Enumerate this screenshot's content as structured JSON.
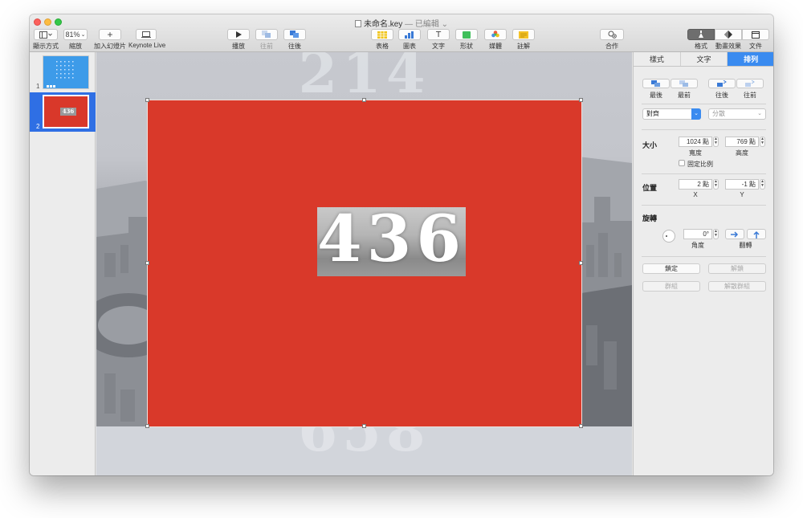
{
  "window": {
    "title": "未命名.key",
    "title_suffix": "— 已編輯",
    "title_chevron": "⌄"
  },
  "toolbar": {
    "view": {
      "label": "顯示方式"
    },
    "zoom": {
      "value": "81%",
      "label": "縮放"
    },
    "add_slide": {
      "label": "加入幻燈片"
    },
    "keynote_live": {
      "label": "Keynote Live"
    },
    "play": {
      "label": "播放"
    },
    "back": {
      "label": "往前"
    },
    "forward": {
      "label": "往後"
    },
    "table": {
      "label": "表格"
    },
    "chart": {
      "label": "圖表"
    },
    "text": {
      "label": "文字",
      "glyph": "T"
    },
    "shape": {
      "label": "形狀"
    },
    "media": {
      "label": "媒體"
    },
    "comment": {
      "label": "註解"
    },
    "collaborate": {
      "label": "合作"
    },
    "format": {
      "label": "格式"
    },
    "animate": {
      "label": "動畫效果"
    },
    "document": {
      "label": "文件"
    }
  },
  "slides": [
    {
      "number": "1"
    },
    {
      "number": "2",
      "mini_text": "436"
    }
  ],
  "canvas": {
    "bg_number_top": "214",
    "bg_number_bottom": "658",
    "center_number": "436"
  },
  "inspector": {
    "tabs": [
      "樣式",
      "文字",
      "排列"
    ],
    "active_tab": "排列",
    "order": {
      "to_back": "最後",
      "to_front": "最前",
      "backward": "往後",
      "forward": "往前"
    },
    "align": {
      "value": "對齊",
      "placeholder": "分散"
    },
    "size": {
      "section": "大小",
      "width": "1024 點",
      "width_label": "寬度",
      "height": "769 點",
      "height_label": "高度",
      "constrain": "固定比例"
    },
    "position": {
      "section": "位置",
      "x": "2 點",
      "x_label": "X",
      "y": "-1 點",
      "y_label": "Y"
    },
    "rotate": {
      "section": "旋轉",
      "angle": "0°",
      "angle_label": "角度",
      "flip_label": "翻轉"
    },
    "lock": "鎖定",
    "unlock": "解鎖",
    "group": "群組",
    "ungroup": "解散群組"
  },
  "colors": {
    "accent": "#3a8bf0",
    "slide_red": "#d9392a",
    "selection_blue": "#2f6fe4"
  }
}
